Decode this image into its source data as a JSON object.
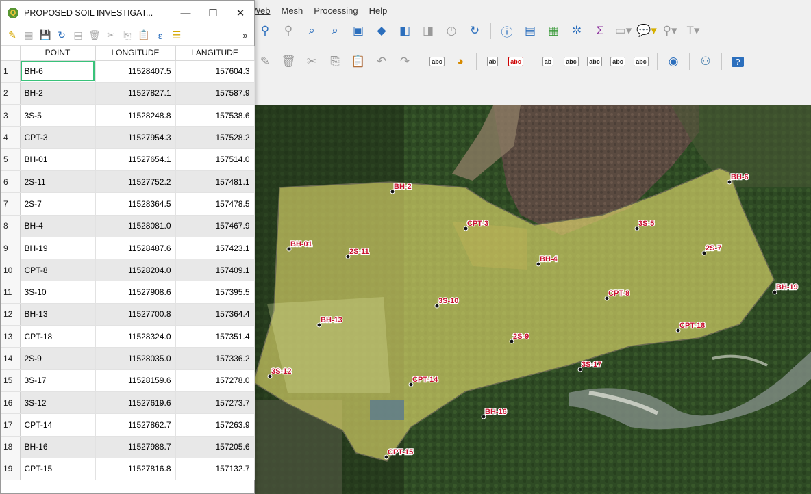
{
  "menu": {
    "items": [
      "Web",
      "Mesh",
      "Processing",
      "Help"
    ]
  },
  "attr_window": {
    "title": "PROPOSED SOIL INVESTIGAT...",
    "buttons": {
      "minimize": "—",
      "maximize": "☐",
      "close": "✕"
    },
    "toolbar_more": "»",
    "columns": [
      "POINT",
      "LONGITUDE",
      "LANGITUDE"
    ],
    "rows": [
      {
        "n": "1",
        "point": "BH-6",
        "lon": "11528407.5",
        "lat": "157604.3"
      },
      {
        "n": "2",
        "point": "BH-2",
        "lon": "11527827.1",
        "lat": "157587.9"
      },
      {
        "n": "3",
        "point": "3S-5",
        "lon": "11528248.8",
        "lat": "157538.6"
      },
      {
        "n": "4",
        "point": "CPT-3",
        "lon": "11527954.3",
        "lat": "157528.2"
      },
      {
        "n": "5",
        "point": "BH-01",
        "lon": "11527654.1",
        "lat": "157514.0"
      },
      {
        "n": "6",
        "point": "2S-11",
        "lon": "11527752.2",
        "lat": "157481.1"
      },
      {
        "n": "7",
        "point": "2S-7",
        "lon": "11528364.5",
        "lat": "157478.5"
      },
      {
        "n": "8",
        "point": "BH-4",
        "lon": "11528081.0",
        "lat": "157467.9"
      },
      {
        "n": "9",
        "point": "BH-19",
        "lon": "11528487.6",
        "lat": "157423.1"
      },
      {
        "n": "10",
        "point": "CPT-8",
        "lon": "11528204.0",
        "lat": "157409.1"
      },
      {
        "n": "11",
        "point": "3S-10",
        "lon": "11527908.6",
        "lat": "157395.5"
      },
      {
        "n": "12",
        "point": "BH-13",
        "lon": "11527700.8",
        "lat": "157364.4"
      },
      {
        "n": "13",
        "point": "CPT-18",
        "lon": "11528324.0",
        "lat": "157351.4"
      },
      {
        "n": "14",
        "point": "2S-9",
        "lon": "11528035.0",
        "lat": "157336.2"
      },
      {
        "n": "15",
        "point": "3S-17",
        "lon": "11528159.6",
        "lat": "157278.0"
      },
      {
        "n": "16",
        "point": "3S-12",
        "lon": "11527619.6",
        "lat": "157273.7"
      },
      {
        "n": "17",
        "point": "CPT-14",
        "lon": "11527862.7",
        "lat": "157263.9"
      },
      {
        "n": "18",
        "point": "BH-16",
        "lon": "11527988.7",
        "lat": "157205.6"
      },
      {
        "n": "19",
        "point": "CPT-15",
        "lon": "11527816.8",
        "lat": "157132.7"
      }
    ]
  },
  "map_labels": [
    "BH-6",
    "BH-2",
    "3S-5",
    "CPT-3",
    "BH-01",
    "2S-11",
    "2S-7",
    "BH-4",
    "BH-19",
    "CPT-8",
    "3S-10",
    "BH-13",
    "CPT-18",
    "2S-9",
    "3S-17",
    "3S-12",
    "CPT-14",
    "BH-16",
    "CPT-15"
  ],
  "colors": {
    "polygon_fill": "#e8e070",
    "label": "#c8102e",
    "selection": "#39c27a"
  }
}
